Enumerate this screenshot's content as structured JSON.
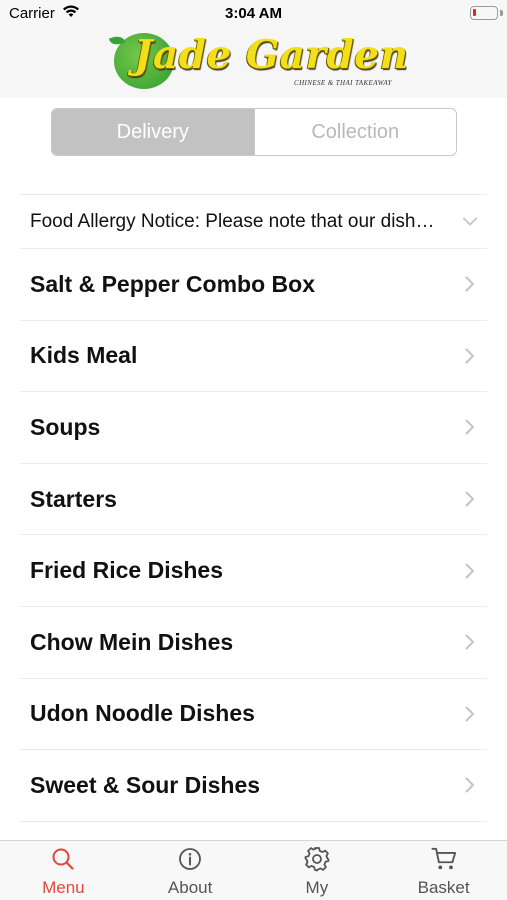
{
  "status_bar": {
    "carrier": "Carrier",
    "time": "3:04 AM"
  },
  "header": {
    "logo_title": "Jade Garden",
    "logo_subtitle": "CHINESE & THAI TAKEAWAY"
  },
  "order_type": {
    "options": [
      "Delivery",
      "Collection"
    ],
    "selected": "Delivery"
  },
  "allergy_notice": "Food Allergy Notice: Please note that our dishes may contain allergens",
  "menu": {
    "categories": [
      "Salt & Pepper Combo Box",
      "Kids Meal",
      "Soups",
      "Starters",
      "Fried Rice Dishes",
      "Chow Mein Dishes",
      "Udon Noodle Dishes",
      "Sweet & Sour Dishes"
    ]
  },
  "tabbar": {
    "tabs": [
      {
        "label": "Menu",
        "icon": "search-icon"
      },
      {
        "label": "About",
        "icon": "info-icon"
      },
      {
        "label": "My",
        "icon": "gear-icon"
      },
      {
        "label": "Basket",
        "icon": "cart-icon"
      }
    ],
    "active": "Menu"
  },
  "colors": {
    "accent": "#e0483d",
    "logo_yellow": "#f2de19",
    "logo_green": "#3aa336",
    "segment_active": "#c2c2c2"
  }
}
